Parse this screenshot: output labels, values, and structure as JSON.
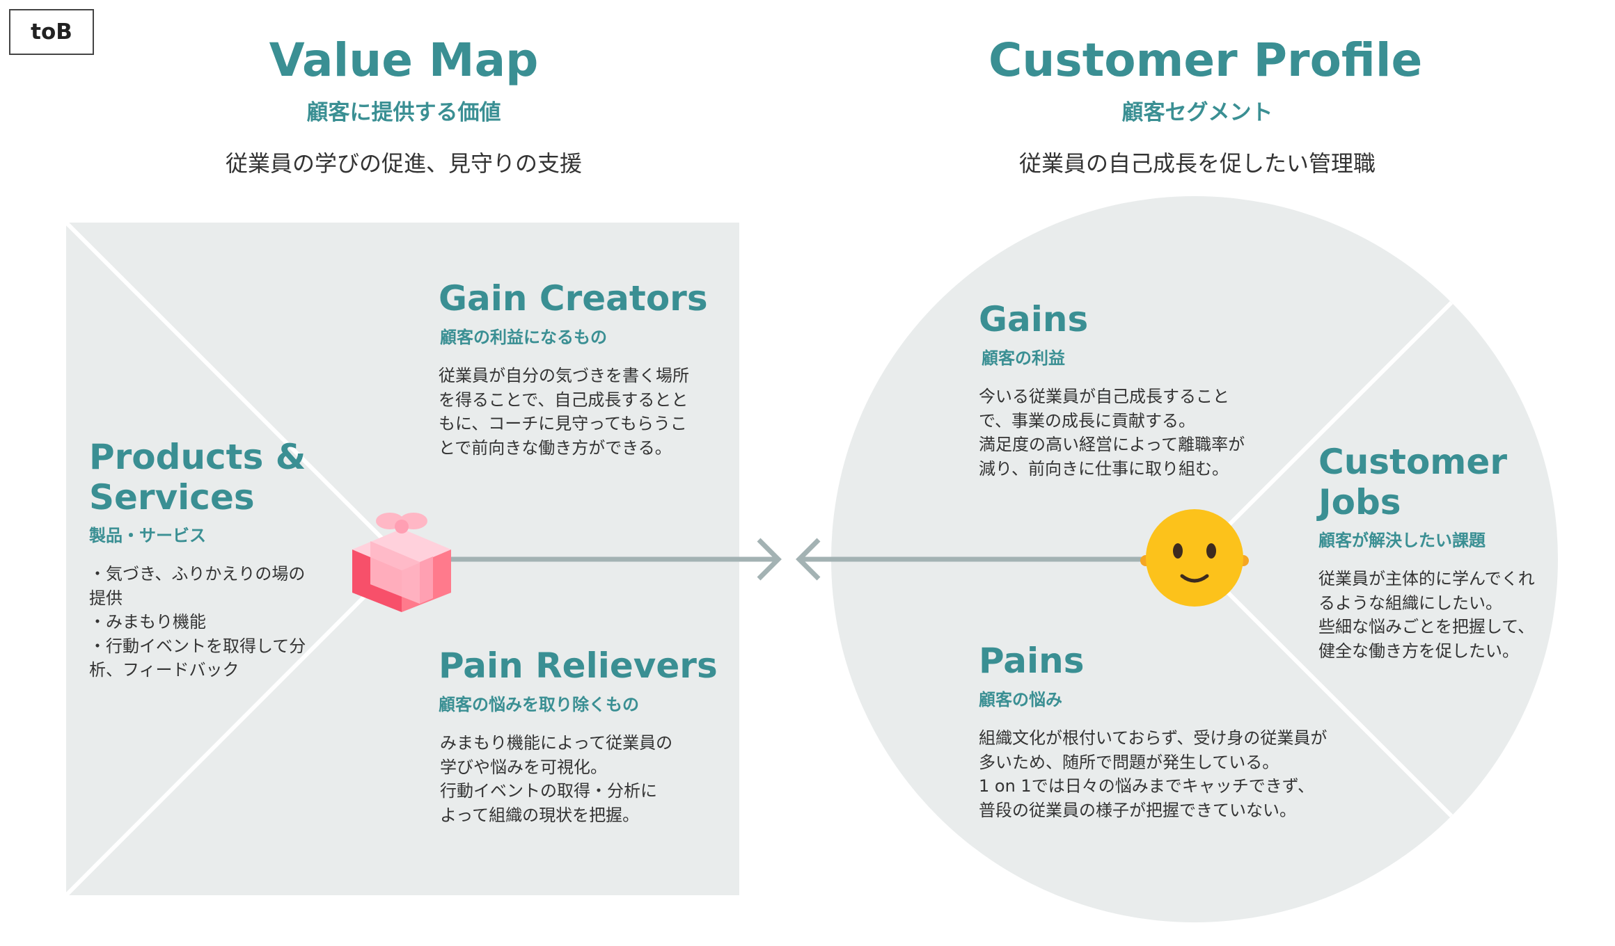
{
  "tag": "toB",
  "value_map": {
    "title": "Value Map",
    "subtitle": "顧客に提供する価値",
    "description": "従業員の学びの促進、見守りの支援"
  },
  "customer_profile": {
    "title": "Customer Profile",
    "subtitle": "顧客セグメント",
    "description": "従業員の自己成長を促したい管理職"
  },
  "gain_creators": {
    "title": "Gain Creators",
    "subtitle": "顧客の利益になるもの",
    "body": "従業員が自分の気づきを書く場所\nを得ることで、自己成長するとと\nもに、コーチに見守ってもらうこ\nとで前向きな働き方ができる。"
  },
  "products_services": {
    "title": "Products &\nServices",
    "subtitle": "製品・サービス",
    "body": "・気づき、ふりかえりの場の\n提供\n・みまもり機能\n・行動イベントを取得して分\n析、フィードバック"
  },
  "pain_relievers": {
    "title": "Pain Relievers",
    "subtitle": "顧客の悩みを取り除くもの",
    "body": "みまもり機能によって従業員の\n学びや悩みを可視化。\n行動イベントの取得・分析に\nよって組織の現状を把握。"
  },
  "gains": {
    "title": "Gains",
    "subtitle": "顧客の利益",
    "body": "今いる従業員が自己成長すること\nで、事業の成長に貢献する。\n満足度の高い経営によって離職率が\n減り、前向きに仕事に取り組む。"
  },
  "customer_jobs": {
    "title": "Customer\nJobs",
    "subtitle": "顧客が解決したい課題",
    "body": "従業員が主体的に学んでくれ\nるような組織にしたい。\n些細な悩みごとを把握して、\n健全な働き方を促したい。"
  },
  "pains": {
    "title": "Pains",
    "subtitle": "顧客の悩み",
    "body": "組織文化が根付いておらず、受け身の従業員が\n多いため、随所で問題が発生している。\n1 on 1では日々の悩みまでキャッチできず、\n普段の従業員の様子が把握できていない。"
  },
  "icons": {
    "value_map": "gift-icon",
    "customer_profile": "smiley-face-icon"
  },
  "colors": {
    "accent": "#3a8f93",
    "panel": "#e9ecec",
    "arrow": "#a3b2b3",
    "gift": "#f7506a",
    "face": "#fcc21b"
  }
}
